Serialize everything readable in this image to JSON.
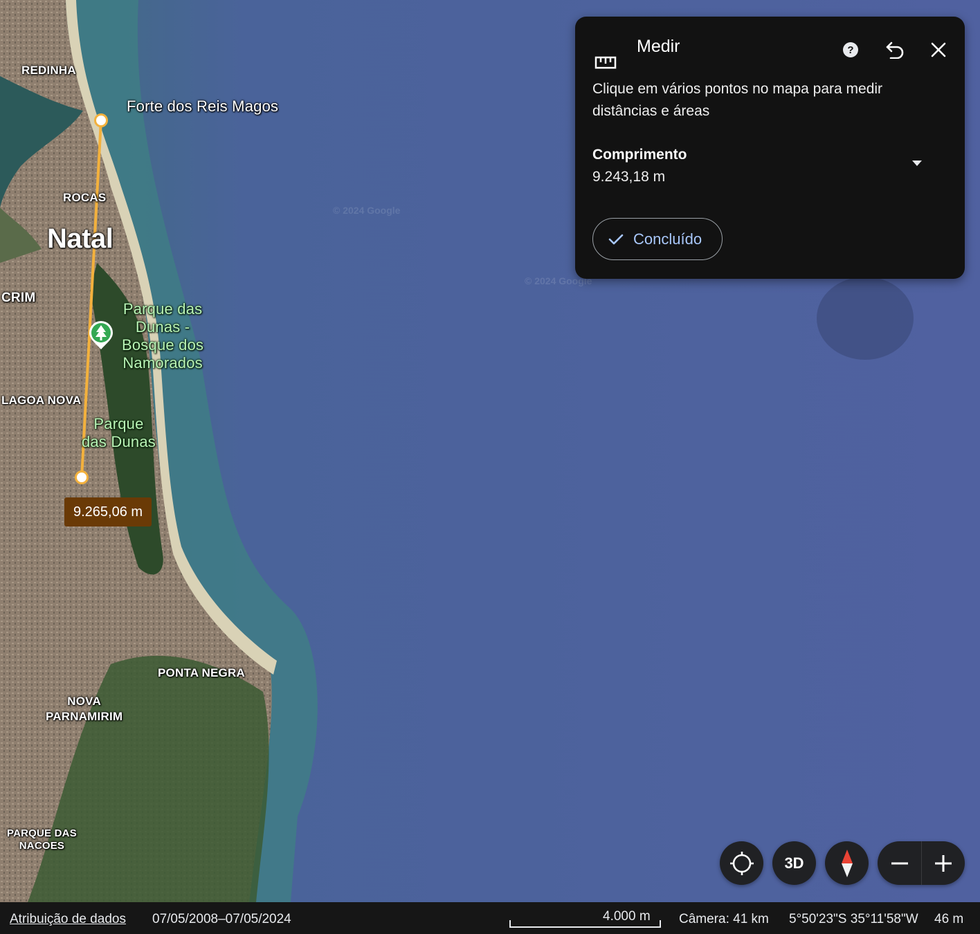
{
  "map": {
    "watermarks": [
      "© 2024 Google",
      "© 2024 Google"
    ],
    "places": {
      "redinha": "REDINHA",
      "rocas": "ROCAS",
      "natal": "Natal",
      "crim": "CRIM",
      "lagoa_nova": "LAGOA NOVA",
      "ponta_negra": "PONTA NEGRA",
      "nova_parnamirim": "NOVA\nPARNAMIRIM",
      "parque_das_nacoes": "PARQUE DAS\nNACOES"
    },
    "poi": {
      "forte": "Forte dos Reis Magos",
      "parque_bosque": "Parque das\nDunas -\nBosque dos\nNamorados",
      "parque_dunas": "Parque\ndas Dunas"
    },
    "measurement_label": "9.265,06 m",
    "colors": {
      "measure_line": "#f3b13d",
      "ocean": "#4f5f9c",
      "label_bg": "#6a3a06"
    }
  },
  "panel": {
    "title": "Medir",
    "icons": {
      "ruler": "ruler-icon",
      "help": "help-icon",
      "undo": "undo-icon",
      "close": "close-icon"
    },
    "description": "Clique em vários pontos no mapa para medir distâncias e áreas",
    "length_title": "Comprimento",
    "length_value": "9.243,18 m",
    "done_label": "Concluído",
    "accent": "#a8c7fa"
  },
  "controls": {
    "threed_label": "3D",
    "icons": {
      "locate": "my-location-icon",
      "compass": "compass-icon",
      "zoom_out": "minus-icon",
      "zoom_in": "plus-icon"
    }
  },
  "status": {
    "attribution": "Atribuição de dados",
    "date_range": "07/05/2008–07/05/2024",
    "scale": "4.000 m",
    "camera": "Câmera: 41 km",
    "coordinates": "5°50'23\"S 35°11'58\"W",
    "elevation": "46 m"
  }
}
